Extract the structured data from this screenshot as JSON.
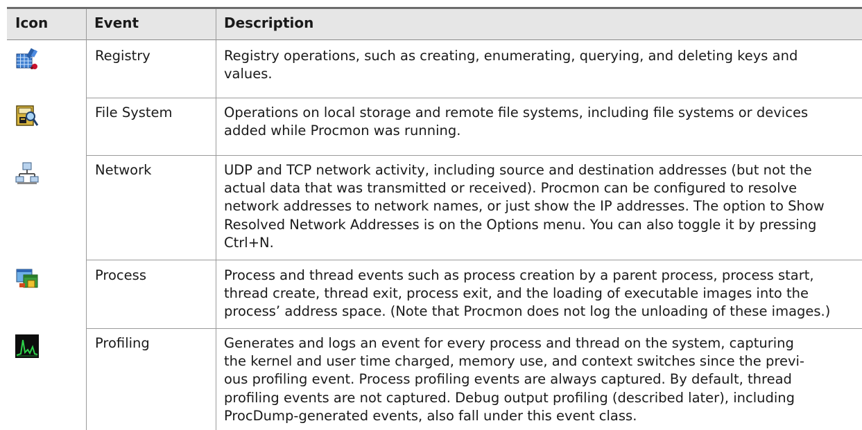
{
  "columns": {
    "icon": "Icon",
    "event": "Event",
    "description": "Description"
  },
  "rows": [
    {
      "icon": "registry-icon",
      "event": "Registry",
      "lines": [
        "Registry operations, such as creating, enumerating, querying, and deleting keys and",
        "values."
      ]
    },
    {
      "icon": "file-system-icon",
      "event": "File System",
      "lines": [
        "Operations on local storage and remote file systems, including file systems or devices",
        "added while Procmon was running."
      ]
    },
    {
      "icon": "network-icon",
      "event": "Network",
      "lines": [
        "UDP and TCP network activity, including source and destination addresses (but not the",
        "actual data that was transmitted or received). Procmon can be configured to resolve",
        "network addresses to network names, or just show the IP addresses. The option to Show",
        "Resolved Network Addresses is on the Options menu. You can also toggle it by pressing",
        "Ctrl+N."
      ]
    },
    {
      "icon": "process-icon",
      "event": "Process",
      "lines": [
        "Process and thread events such as process creation by a parent process, process start,",
        "thread create, thread exit, process exit, and the loading of executable images into the",
        "process’ address space. (Note that Procmon does not log the unloading of these images.)"
      ]
    },
    {
      "icon": "profiling-icon",
      "event": "Profiling",
      "lines": [
        "Generates and logs an event for every process and thread on the system, capturing",
        "the kernel and user time charged, memory use, and context switches since the previ-",
        "ous profiling event. Process profiling events are always captured. By default, thread",
        "profiling events are not captured. Debug output profiling (described later), including",
        "ProcDump-generated events, also fall under this event class."
      ]
    }
  ]
}
